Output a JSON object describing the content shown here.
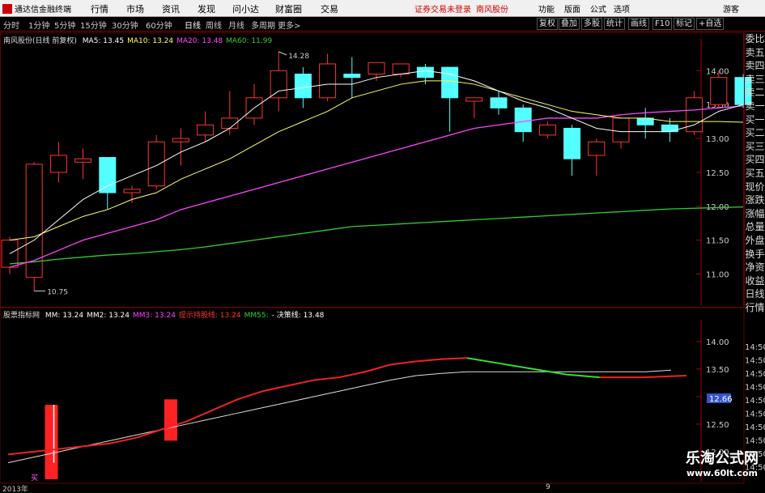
{
  "app": {
    "title": "通达信金融终端"
  },
  "menu": [
    "行情",
    "市场",
    "资讯",
    "发现",
    "问小达",
    "财富圈",
    "交易"
  ],
  "notice": "证券交易未登录",
  "stock_name": "南风股份",
  "top_right": [
    "功能",
    "版面",
    "公式",
    "选项",
    "游客"
  ],
  "periods": [
    "分时",
    "1分钟",
    "5分钟",
    "15分钟",
    "30分钟",
    "60分钟",
    "日线",
    "周线",
    "月线",
    "多周期",
    "更多>"
  ],
  "active_period": "日线",
  "right_tabs": [
    "复权",
    "叠加",
    "多股",
    "统计",
    "画线",
    "F10",
    "标记",
    "+自选"
  ],
  "main_legend": {
    "title": "南风股份(日线 前复权)",
    "ma": [
      {
        "label": "MA5: 13.45",
        "color": "#ffffff"
      },
      {
        "label": "MA10: 13.24",
        "color": "#ffff66"
      },
      {
        "label": "MA20: 13.48",
        "color": "#ff44ff"
      },
      {
        "label": "MA60: 11.99",
        "color": "#33cc33"
      }
    ]
  },
  "main_annot": {
    "high": "14.28",
    "low": "10.75"
  },
  "main_axis": [
    "14.00",
    "13.50",
    "13.00",
    "12.50",
    "12.00",
    "11.50",
    "11.00"
  ],
  "sidebar": [
    "委比",
    "卖五",
    "卖四",
    "卖三",
    "卖二",
    "卖一",
    "买一",
    "买二",
    "买三",
    "买四",
    "买五",
    "现价",
    "涨跌",
    "涨幅",
    "总量",
    "外盘",
    "换手",
    "净资",
    "收益",
    "日线",
    "行情"
  ],
  "sub_legend": {
    "title": "股票指标网",
    "items": [
      {
        "label": "MM: 13.24",
        "color": "#ffffff"
      },
      {
        "label": "MM2: 13.24",
        "color": "#ffffff"
      },
      {
        "label": "MM3: 13.24",
        "color": "#ff44ff"
      },
      {
        "label": "提示持股线: 13.24",
        "color": "#ff3333"
      },
      {
        "label": "MM55:",
        "color": "#33cc33"
      },
      {
        "label": "- 决策线: 13.48",
        "color": "#ffffff"
      }
    ]
  },
  "sub_axis": [
    "14.00",
    "13.50",
    "13.00",
    "12.50",
    "12.00"
  ],
  "sub_axis_right": [
    "14:50",
    "14:50",
    "14:50",
    "14:50",
    "14:50",
    "14:50",
    "14:50",
    "14:50",
    "14:50",
    "14:50"
  ],
  "sub_current": "12.66",
  "x_labels": [
    "2013年",
    "9"
  ],
  "sub_marker": "买",
  "watermark": {
    "line1": "乐淘公式网",
    "line2": "www.60lt.com"
  },
  "chart_data": {
    "type": "candlestick",
    "ylim": [
      10.6,
      14.35
    ],
    "candles": [
      {
        "o": 11.1,
        "h": 11.55,
        "l": 11.0,
        "c": 11.5
      },
      {
        "o": 10.95,
        "h": 12.65,
        "l": 10.75,
        "c": 12.62
      },
      {
        "o": 12.5,
        "h": 12.95,
        "l": 12.35,
        "c": 12.75
      },
      {
        "o": 12.65,
        "h": 12.85,
        "l": 12.4,
        "c": 12.7
      },
      {
        "o": 12.72,
        "h": 12.72,
        "l": 11.95,
        "c": 12.2
      },
      {
        "o": 12.2,
        "h": 12.3,
        "l": 12.05,
        "c": 12.25
      },
      {
        "o": 12.3,
        "h": 13.05,
        "l": 12.25,
        "c": 12.95
      },
      {
        "o": 12.95,
        "h": 13.15,
        "l": 12.6,
        "c": 13.0
      },
      {
        "o": 13.05,
        "h": 13.4,
        "l": 12.95,
        "c": 13.2
      },
      {
        "o": 13.15,
        "h": 13.7,
        "l": 13.05,
        "c": 13.3
      },
      {
        "o": 13.3,
        "h": 13.8,
        "l": 13.2,
        "c": 13.6
      },
      {
        "o": 13.6,
        "h": 14.28,
        "l": 13.4,
        "c": 14.0
      },
      {
        "o": 13.95,
        "h": 14.05,
        "l": 13.45,
        "c": 13.6
      },
      {
        "o": 13.6,
        "h": 14.25,
        "l": 13.55,
        "c": 14.1
      },
      {
        "o": 13.95,
        "h": 14.2,
        "l": 13.6,
        "c": 13.9
      },
      {
        "o": 13.95,
        "h": 14.12,
        "l": 13.85,
        "c": 14.12
      },
      {
        "o": 13.95,
        "h": 14.1,
        "l": 13.9,
        "c": 14.1
      },
      {
        "o": 14.05,
        "h": 14.1,
        "l": 13.8,
        "c": 13.9
      },
      {
        "o": 14.05,
        "h": 14.05,
        "l": 13.1,
        "c": 13.6
      },
      {
        "o": 13.55,
        "h": 13.6,
        "l": 13.3,
        "c": 13.6
      },
      {
        "o": 13.6,
        "h": 13.7,
        "l": 13.35,
        "c": 13.45
      },
      {
        "o": 13.45,
        "h": 13.5,
        "l": 12.95,
        "c": 13.1
      },
      {
        "o": 13.05,
        "h": 13.25,
        "l": 13.0,
        "c": 13.2
      },
      {
        "o": 13.15,
        "h": 13.2,
        "l": 12.45,
        "c": 12.7
      },
      {
        "o": 12.75,
        "h": 13.0,
        "l": 12.45,
        "c": 12.95
      },
      {
        "o": 12.95,
        "h": 13.3,
        "l": 12.85,
        "c": 13.3
      },
      {
        "o": 13.3,
        "h": 13.45,
        "l": 13.0,
        "c": 13.2
      },
      {
        "o": 13.2,
        "h": 13.3,
        "l": 12.95,
        "c": 13.1
      },
      {
        "o": 13.1,
        "h": 13.7,
        "l": 13.05,
        "c": 13.6
      },
      {
        "o": 13.5,
        "h": 14.0,
        "l": 13.45,
        "c": 13.9
      },
      {
        "o": 13.9,
        "h": 13.95,
        "l": 13.45,
        "c": 13.5
      }
    ],
    "ma5": [
      11.3,
      11.5,
      11.8,
      12.1,
      12.3,
      12.45,
      12.6,
      12.8,
      12.95,
      13.15,
      13.45,
      13.7,
      13.75,
      13.8,
      13.8,
      13.9,
      13.95,
      14.0,
      13.95,
      13.85,
      13.7,
      13.55,
      13.45,
      13.3,
      13.15,
      13.1,
      13.1,
      13.1,
      13.2,
      13.4,
      13.5
    ],
    "ma10": [
      11.5,
      11.55,
      11.7,
      11.85,
      11.95,
      12.1,
      12.2,
      12.4,
      12.55,
      12.7,
      12.9,
      13.1,
      13.25,
      13.4,
      13.6,
      13.7,
      13.8,
      13.85,
      13.85,
      13.8,
      13.7,
      13.6,
      13.5,
      13.4,
      13.35,
      13.3,
      13.3,
      13.25,
      13.25,
      13.25,
      13.24
    ],
    "ma20": [
      11.1,
      11.2,
      11.35,
      11.5,
      11.6,
      11.7,
      11.8,
      11.95,
      12.05,
      12.15,
      12.25,
      12.35,
      12.45,
      12.55,
      12.65,
      12.75,
      12.85,
      12.95,
      13.05,
      13.15,
      13.2,
      13.25,
      13.3,
      13.3,
      13.3,
      13.35,
      13.38,
      13.4,
      13.42,
      13.45,
      13.48
    ],
    "ma60": [
      11.15,
      11.18,
      11.22,
      11.25,
      11.28,
      11.3,
      11.33,
      11.36,
      11.4,
      11.45,
      11.5,
      11.55,
      11.6,
      11.65,
      11.7,
      11.72,
      11.74,
      11.76,
      11.78,
      11.8,
      11.82,
      11.84,
      11.86,
      11.88,
      11.9,
      11.92,
      11.94,
      11.96,
      11.97,
      11.98,
      11.99
    ],
    "sub": {
      "ylim": [
        11.5,
        14.35
      ],
      "red_line": [
        11.95,
        12.0,
        12.05,
        12.1,
        12.15,
        12.25,
        12.4,
        12.55,
        12.75,
        12.95,
        13.1,
        13.2,
        13.3,
        13.35,
        13.45,
        13.58,
        13.64,
        13.68,
        13.7
      ],
      "green_line": [
        13.7,
        13.6,
        13.5,
        13.4,
        13.35
      ],
      "red_tail": [
        13.35,
        13.35,
        13.38
      ],
      "white_line": [
        11.8,
        11.9,
        12.0,
        12.1,
        12.2,
        12.3,
        12.4,
        12.5,
        12.6,
        12.7,
        12.8,
        12.9,
        13.0,
        13.1,
        13.2,
        13.3,
        13.38,
        13.42,
        13.45,
        13.45,
        13.45,
        13.45,
        13.45,
        13.45,
        13.45,
        13.45,
        13.48
      ],
      "bars": [
        {
          "i": 1,
          "bottom": 11.5,
          "top": 12.85
        },
        {
          "i": 6,
          "bottom": 12.2,
          "top": 12.95
        }
      ]
    }
  }
}
